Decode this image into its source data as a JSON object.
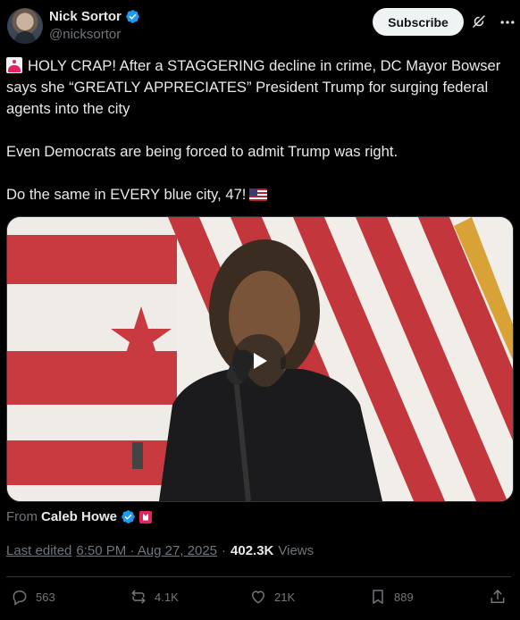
{
  "author": {
    "name": "Nick Sortor",
    "handle": "@nicksortor",
    "verified_color": "#1d9bf0"
  },
  "header": {
    "subscribe_label": "Subscribe",
    "grok_icon": "grok-icon",
    "more_icon": "more-horizontal-icon"
  },
  "tweet": {
    "line1": "HOLY CRAP! After a STAGGERING decline in crime, DC Mayor Bowser says she “GREATLY APPRECIATES” President Trump for surging federal agents into the city",
    "line2": "Even Democrats are being forced to admit Trump was right.",
    "line3": "Do the same in EVERY blue city, 47!",
    "emoji_start": "siren-emoji",
    "emoji_end": "us-flag-emoji"
  },
  "video": {
    "play_icon": "play-icon"
  },
  "source": {
    "from_label": "From",
    "name": "Caleb Howe"
  },
  "meta": {
    "edited_label": "Last edited",
    "timestamp": "6:50 PM · Aug 27, 2025",
    "separator": "·",
    "views_count": "402.3K",
    "views_label": "Views"
  },
  "actions": {
    "replies": "563",
    "reposts": "4.1K",
    "likes": "21K",
    "bookmarks": "889"
  },
  "colors": {
    "background": "#000000",
    "text": "#e7e9ea",
    "muted": "#71767b",
    "accent": "#1d9bf0"
  }
}
